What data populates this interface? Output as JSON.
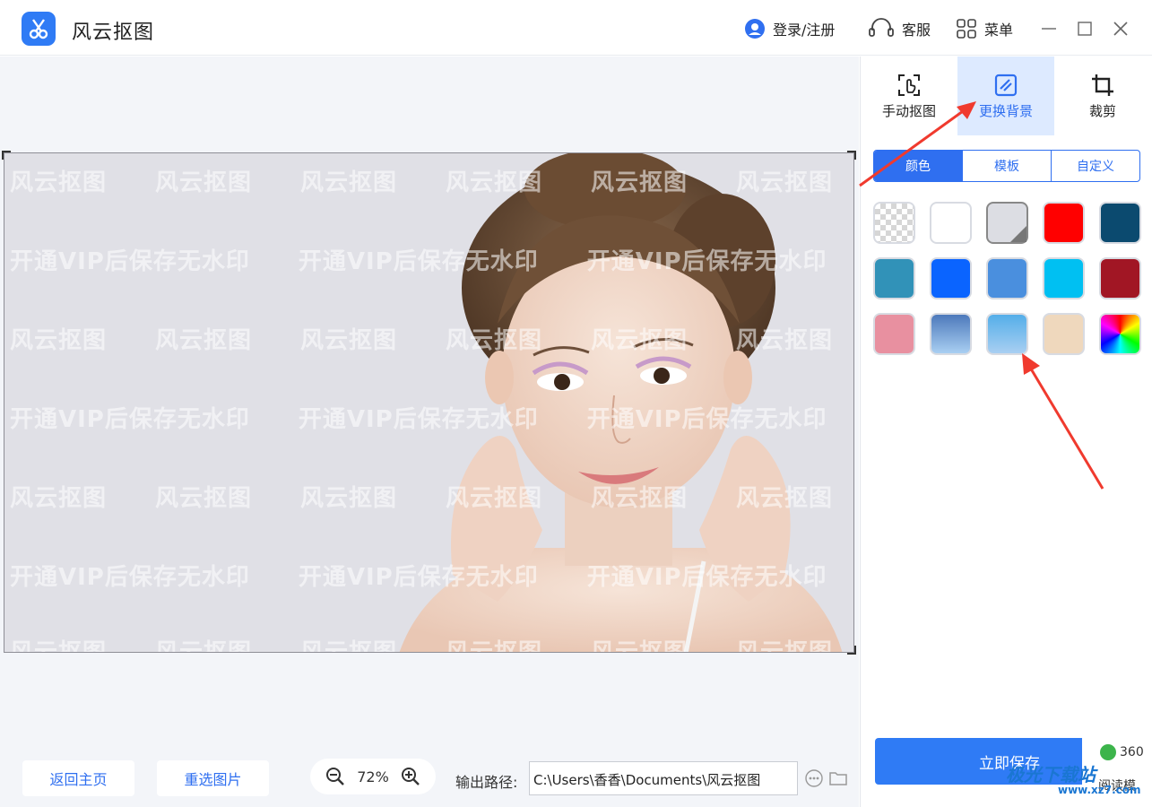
{
  "app": {
    "title": "风云抠图",
    "login": "登录/注册",
    "service": "客服",
    "menu": "菜单"
  },
  "watermark": {
    "row_a": "风云抠图　　风云抠图　　风云抠图　　风云抠图　　风云抠图　　风云抠图　　风云抠图",
    "row_b": "开通VIP后保存无水印　　开通VIP后保存无水印　　开通VIP后保存无水印"
  },
  "canvas_bottom": {
    "home_button": "返回主页",
    "reselect_button": "重选图片",
    "zoom": "72%",
    "output_label": "输出路径:",
    "output_path": "C:\\Users\\香香\\Documents\\风云抠图"
  },
  "tools": {
    "manual": "手动抠图",
    "replace_bg": "更换背景",
    "crop": "裁剪"
  },
  "bg_tabs": {
    "color": "颜色",
    "template": "模板",
    "custom": "自定义"
  },
  "swatches": [
    {
      "name": "transparent",
      "color": "checker"
    },
    {
      "name": "white",
      "color": "#ffffff"
    },
    {
      "name": "light-gray",
      "color": "#dcdde3"
    },
    {
      "name": "red",
      "color": "#ff0000"
    },
    {
      "name": "dark-navy",
      "color": "#0b4a6f"
    },
    {
      "name": "teal-blue",
      "color": "#3192b8"
    },
    {
      "name": "blue",
      "color": "#0a64ff"
    },
    {
      "name": "mid-blue",
      "color": "#4a8fde"
    },
    {
      "name": "sky-blue",
      "color": "#00c0f2"
    },
    {
      "name": "dark-red",
      "color": "#a11624"
    },
    {
      "name": "pink",
      "color": "#e890a0"
    },
    {
      "name": "steel-blue-gradient",
      "color": "#4d79bb"
    },
    {
      "name": "light-blue-gradient",
      "color": "#54aee9"
    },
    {
      "name": "beige",
      "color": "#efd8bd"
    },
    {
      "name": "rainbow",
      "color": "rainbow"
    }
  ],
  "save_button": "立即保存",
  "overlay": {
    "popup_line1": "360",
    "popup_line2": "阅读模",
    "site_name": "极光下载站",
    "site_url": "www.xz7.com"
  },
  "colors": {
    "accent": "#2f7bf5",
    "annotation_arrow": "#f03a2e"
  }
}
